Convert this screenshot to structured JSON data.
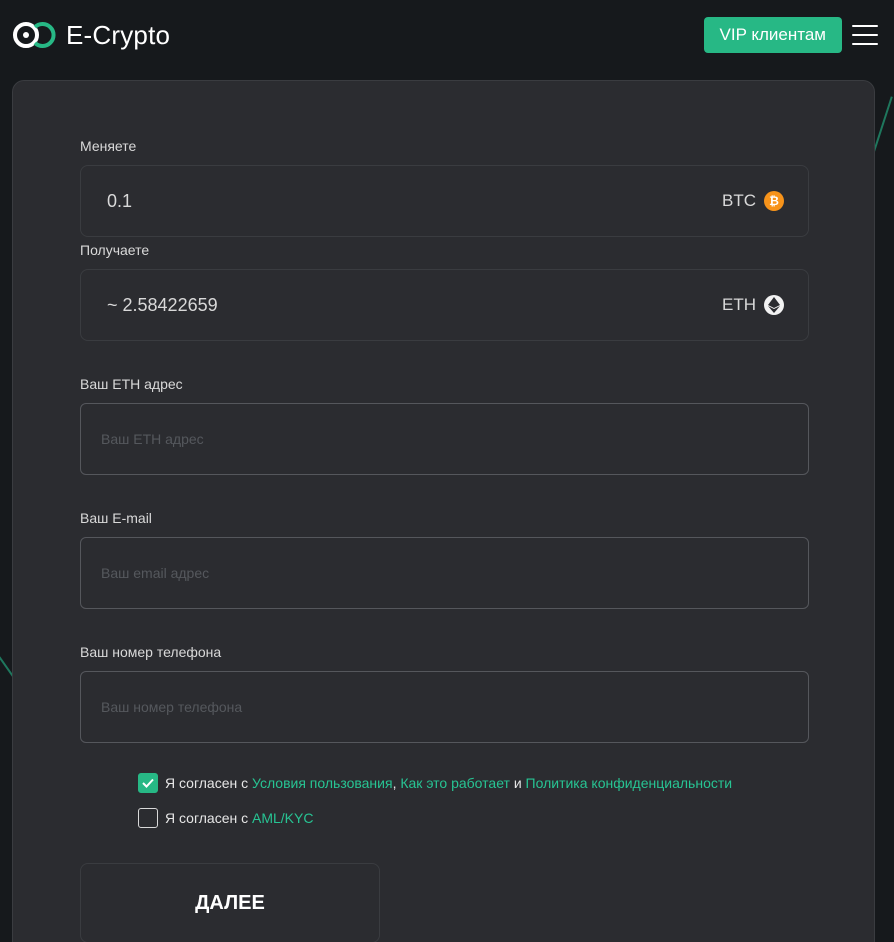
{
  "header": {
    "brand_name": "E-Crypto",
    "vip_label": "VIP клиентам"
  },
  "exchange": {
    "give_label": "Меняете",
    "give_amount": "0.1",
    "give_currency": "BTC",
    "get_label": "Получаете",
    "get_amount": "~ 2.58422659",
    "get_currency": "ETH"
  },
  "form": {
    "eth_address_label": "Ваш ETH адрес",
    "eth_address_placeholder": "Ваш ETH адрес",
    "eth_address_value": "",
    "email_label": "Ваш E-mail",
    "email_placeholder": "Ваш email адрес",
    "email_value": "",
    "phone_label": "Ваш номер телефона",
    "phone_placeholder": "Ваш номер телефона",
    "phone_value": ""
  },
  "agreements": {
    "terms": {
      "checked": true,
      "prefix": "Я согласен с",
      "link1": "Условия пользования",
      "sep1": ",",
      "link2": "Как это работает",
      "sep2": "и",
      "link3": "Политика конфиденциальности"
    },
    "aml": {
      "checked": false,
      "prefix": "Я согласен с",
      "link": "AML/KYC"
    }
  },
  "next_label": "ДАЛЕЕ",
  "colors": {
    "accent": "#27b885",
    "background": "#16191c",
    "card": "#2b2c30",
    "btc": "#f7931a"
  },
  "icons": {
    "logo": "e-crypto-logo-icon",
    "menu": "hamburger-menu-icon",
    "btc": "bitcoin-icon",
    "eth": "ethereum-icon",
    "check": "checkmark-icon"
  }
}
